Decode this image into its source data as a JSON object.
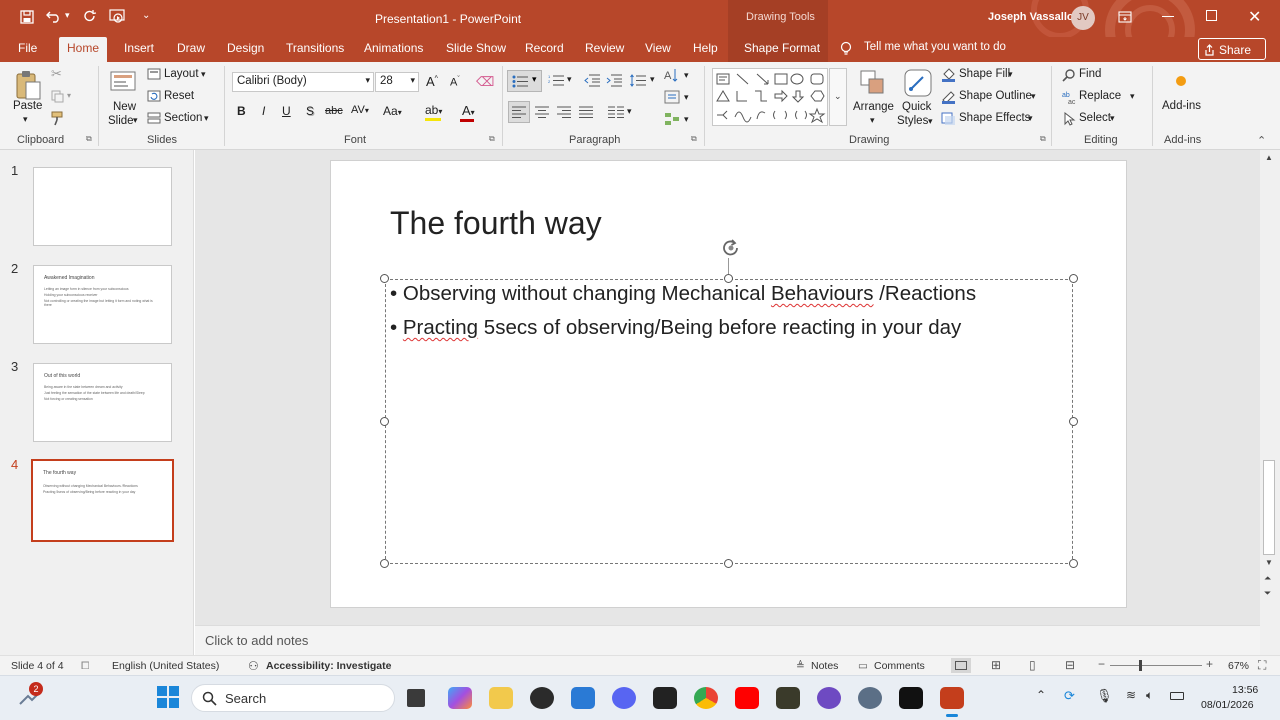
{
  "titlebar": {
    "doc_title": "Presentation1  -  PowerPoint",
    "context_tab_header": "Drawing Tools",
    "user_name": "Joseph Vassallo",
    "user_initials": "JV"
  },
  "tabs": [
    "File",
    "Home",
    "Insert",
    "Draw",
    "Design",
    "Transitions",
    "Animations",
    "Slide Show",
    "Record",
    "Review",
    "View",
    "Help",
    "Shape Format"
  ],
  "tell_me": "Tell me what you want to do",
  "share_label": "Share",
  "ribbon": {
    "clipboard": {
      "paste": "Paste",
      "group": "Clipboard"
    },
    "slides": {
      "new_slide_1": "New",
      "new_slide_2": "Slide",
      "layout": "Layout",
      "reset": "Reset",
      "section": "Section",
      "group": "Slides"
    },
    "font": {
      "font_name": "Calibri (Body)",
      "font_size": "28",
      "group": "Font"
    },
    "paragraph": {
      "group": "Paragraph"
    },
    "drawing": {
      "arrange": "Arrange",
      "quick_styles_1": "Quick",
      "quick_styles_2": "Styles",
      "shape_fill": "Shape Fill",
      "shape_outline": "Shape Outline",
      "shape_effects": "Shape Effects",
      "group": "Drawing"
    },
    "editing": {
      "find": "Find",
      "replace": "Replace",
      "select": "Select",
      "group": "Editing"
    },
    "addins": {
      "button": "Add-ins",
      "group": "Add-ins"
    }
  },
  "thumbnails": [
    {
      "num": "1",
      "title": "",
      "bullets": []
    },
    {
      "num": "2",
      "title": "Awakened Imagination",
      "bullets": [
        "Letting an image form in silence from your subconscious",
        "Holding your subconscious receiver",
        "Not controlling or creating the image but letting it form and noting what is there"
      ]
    },
    {
      "num": "3",
      "title": "Out of this world",
      "bullets": [
        "Being aware in the state between dream and activity",
        "Just feeling the sensation of the state between life and death/Sleep",
        "Not forcing or creating sensation"
      ]
    },
    {
      "num": "4",
      "title": "The fourth way",
      "bullets": [
        "Observing without changing Mechanical Behaviours /Reactions",
        "Practing 5secs of observing/Being before reacting in your day"
      ]
    }
  ],
  "slide": {
    "title": "The fourth way",
    "bullet_1_a": "Observing without changing Mechanical ",
    "bullet_1_b": "Behaviours",
    "bullet_1_c": " /Reactions",
    "bullet_2_a": "Practing",
    "bullet_2_b": " 5secs of observing/Being before reacting in your day"
  },
  "notes_placeholder": "Click to add notes",
  "status": {
    "slide_counter": "Slide 4 of 4",
    "language": "English (United States)",
    "accessibility": "Accessibility: Investigate",
    "notes": "Notes",
    "comments": "Comments",
    "zoom": "67%"
  },
  "taskbar": {
    "search": "Search",
    "notification_count": "2",
    "time": "13:56",
    "date": "08/01/2026"
  },
  "colors": {
    "accent": "#b7472a",
    "selection": "#c43e1c"
  }
}
